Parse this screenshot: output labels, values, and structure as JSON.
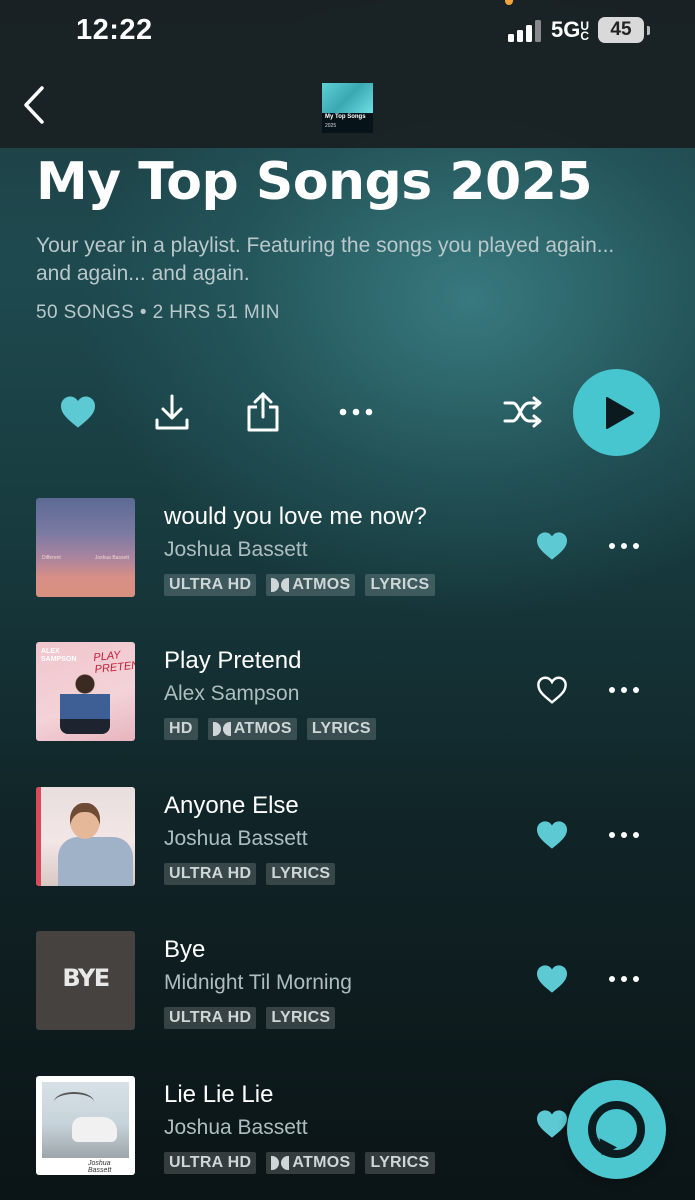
{
  "status_bar": {
    "time": "12:22",
    "network": "5GUC",
    "battery": "45"
  },
  "header": {
    "back_icon": "chevron-left-icon",
    "cover_title": "My Top Songs",
    "cover_year": "2025"
  },
  "playlist": {
    "title": "My Top Songs 2025",
    "description": "Your year in a playlist. Featuring the songs you played again... and again... and again.",
    "meta": "50 SONGS  •  2 HRS 51 MIN"
  },
  "controls": {
    "icons": [
      "heart-icon",
      "download-icon",
      "share-icon",
      "more-icon",
      "shuffle-icon",
      "play-icon"
    ],
    "accent_color": "#48c6cf"
  },
  "tracks": [
    {
      "title": "would you love me now?",
      "artist": "Joshua Bassett",
      "badges": [
        "ULTRA HD",
        "ATMOS",
        "LYRICS"
      ],
      "liked": true,
      "cover_text_left": "Different",
      "cover_text_right": "Joshua Bassett"
    },
    {
      "title": "Play Pretend",
      "artist": "Alex Sampson",
      "badges": [
        "HD",
        "ATMOS",
        "LYRICS"
      ],
      "liked": false,
      "cover_text_left": "ALEX SAMPSON",
      "cover_text_right": "PLAY PRETEND"
    },
    {
      "title": "Anyone Else",
      "artist": "Joshua Bassett",
      "badges": [
        "ULTRA HD",
        "LYRICS"
      ],
      "liked": true
    },
    {
      "title": "Bye",
      "artist": "Midnight Til Morning",
      "badges": [
        "ULTRA HD",
        "LYRICS"
      ],
      "liked": true,
      "cover_text": "BYE"
    },
    {
      "title": "Lie Lie Lie",
      "artist": "Joshua Bassett",
      "badges": [
        "ULTRA HD",
        "ATMOS",
        "LYRICS"
      ],
      "liked": true,
      "cover_text": "Joshua Bassett"
    }
  ],
  "alexa": {
    "icon": "alexa-icon"
  }
}
